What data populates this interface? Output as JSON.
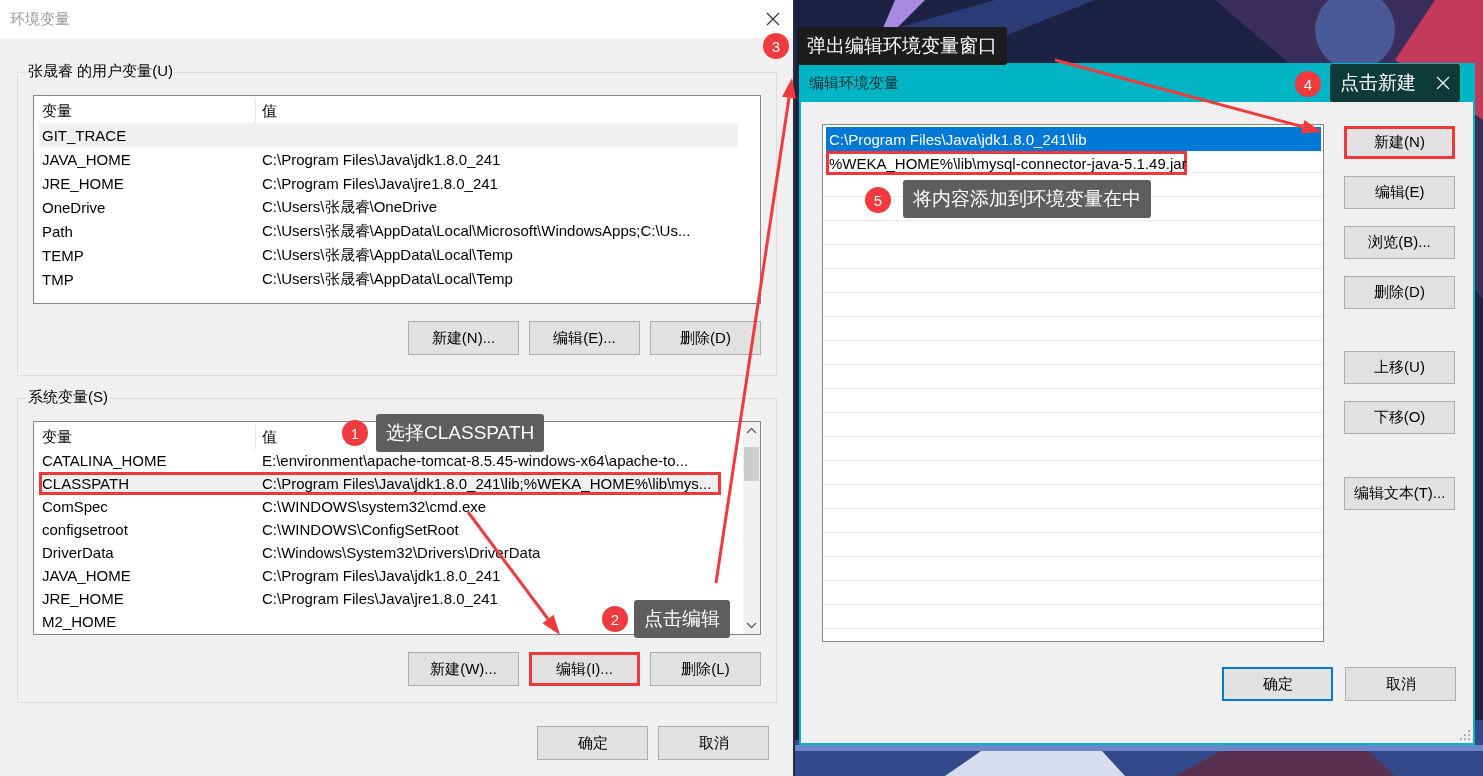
{
  "main_dialog": {
    "title": "环境变量",
    "user_variables": {
      "label": "张晟睿 的用户变量(U)",
      "columns": [
        "变量",
        "值"
      ],
      "rows": [
        {
          "name": "GIT_TRACE",
          "selected": true,
          "highlighted": false
        },
        {
          "name": "JAVA_HOME",
          "value": "C:\\Program Files\\Java\\jdk1.8.0_241",
          "selected": false,
          "highlighted": false
        },
        {
          "name": "JRE_HOME",
          "value": "C:\\Program Files\\Java\\jre1.8.0_241",
          "selected": false,
          "highlighted": false
        },
        {
          "name": "OneDrive",
          "value": "C:\\Users\\张晟睿\\OneDrive",
          "selected": false,
          "highlighted": false
        },
        {
          "name": "Path",
          "value": "C:\\Users\\张晟睿\\AppData\\Local\\Microsoft\\WindowsApps;C:\\Us...",
          "selected": false,
          "highlighted": false
        },
        {
          "name": "TEMP",
          "value": "C:\\Users\\张晟睿\\AppData\\Local\\Temp",
          "selected": false,
          "highlighted": false
        },
        {
          "name": "TMP",
          "value": "C:\\Users\\张晟睿\\AppData\\Local\\Temp",
          "selected": false,
          "highlighted": false
        }
      ],
      "buttons": [
        {
          "label": "新建(N)...",
          "highlighted": false
        },
        {
          "label": "编辑(E)...",
          "highlighted": false
        },
        {
          "label": "删除(D)",
          "highlighted": false
        }
      ]
    },
    "system_variables": {
      "label": "系统变量(S)",
      "columns": [
        "变量",
        "值"
      ],
      "rows": [
        {
          "name": "CATALINA_HOME",
          "value": "E:\\environment\\apache-tomcat-8.5.45-windows-x64\\apache-to...",
          "selected": false,
          "highlighted": false
        },
        {
          "name": "CLASSPATH",
          "value": "C:\\Program Files\\Java\\jdk1.8.0_241\\lib;%WEKA_HOME%\\lib\\mys...",
          "selected": true,
          "highlighted": true
        },
        {
          "name": "ComSpec",
          "value": "C:\\WINDOWS\\system32\\cmd.exe",
          "selected": false,
          "highlighted": false
        },
        {
          "name": "configsetroot",
          "value": "C:\\WINDOWS\\ConfigSetRoot",
          "selected": false,
          "highlighted": false
        },
        {
          "name": "DriverData",
          "value": "C:\\Windows\\System32\\Drivers\\DriverData",
          "selected": false,
          "highlighted": false
        },
        {
          "name": "JAVA_HOME",
          "value": "C:\\Program Files\\Java\\jdk1.8.0_241",
          "selected": false,
          "highlighted": false
        },
        {
          "name": "JRE_HOME",
          "value": "C:\\Program Files\\Java\\jre1.8.0_241",
          "selected": false,
          "highlighted": false
        },
        {
          "name": "M2_HOME",
          "selected": false,
          "highlighted": false
        }
      ],
      "buttons": [
        {
          "label": "新建(W)...",
          "highlighted": false
        },
        {
          "label": "编辑(I)...",
          "highlighted": true
        },
        {
          "label": "删除(L)",
          "highlighted": false
        }
      ]
    },
    "buttons": [
      {
        "label": "确定"
      },
      {
        "label": "取消"
      }
    ]
  },
  "edit_dialog": {
    "title": "编辑环境变量",
    "entries": [
      {
        "text": "C:\\Program Files\\Java\\jdk1.8.0_241\\lib",
        "selected": true,
        "highlighted": false
      },
      {
        "text": "%WEKA_HOME%\\lib\\mysql-connector-java-5.1.49.jar",
        "selected": false,
        "highlighted": true
      }
    ],
    "side_buttons": [
      {
        "label": "新建(N)",
        "highlighted": true
      },
      {
        "label": "编辑(E)",
        "highlighted": false
      },
      {
        "label": "浏览(B)...",
        "highlighted": false
      },
      {
        "label": "删除(D)",
        "highlighted": false
      },
      {
        "label": "上移(U)",
        "highlighted": false
      },
      {
        "label": "下移(O)",
        "highlighted": false
      },
      {
        "label": "编辑文本(T)...",
        "highlighted": false
      }
    ],
    "buttons": [
      {
        "label": "确定",
        "default": true
      },
      {
        "label": "取消",
        "default": false
      }
    ]
  },
  "annotations": [
    {
      "number": "1",
      "text": "选择CLASSPATH",
      "kind": "grey",
      "closable": false
    },
    {
      "number": "2",
      "text": "点击编辑",
      "kind": "grey",
      "closable": false
    },
    {
      "number": "3",
      "text": "弹出编辑环境变量窗口",
      "kind": "dark",
      "closable": false
    },
    {
      "number": "4",
      "text": "点击新建",
      "kind": "teal",
      "closable": true
    },
    {
      "number": "5",
      "text": "将内容添加到环境变量在中",
      "kind": "grey",
      "closable": false
    }
  ]
}
